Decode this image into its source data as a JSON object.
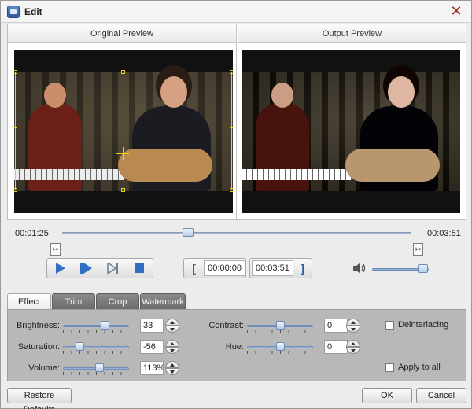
{
  "window": {
    "title": "Edit"
  },
  "preview": {
    "original_header": "Original Preview",
    "output_header": "Output Preview"
  },
  "timeline": {
    "current_time": "00:01:25",
    "total_time": "00:03:51",
    "position_fraction": 0.36
  },
  "playback": {
    "start_time": "00:00:00",
    "end_time": "00:03:51",
    "volume_fraction": 0.9
  },
  "tabs": [
    {
      "label": "Effect",
      "active": true
    },
    {
      "label": "Trim",
      "active": false
    },
    {
      "label": "Crop",
      "active": false
    },
    {
      "label": "Watermark",
      "active": false
    }
  ],
  "effect": {
    "brightness": {
      "label": "Brightness:",
      "value": "33",
      "level": 0.66
    },
    "saturation": {
      "label": "Saturation:",
      "value": "-56",
      "level": 0.22
    },
    "volume": {
      "label": "Volume:",
      "value": "113%",
      "level": 0.56
    },
    "contrast": {
      "label": "Contrast:",
      "value": "0",
      "level": 0.5
    },
    "hue": {
      "label": "Hue:",
      "value": "0",
      "level": 0.5
    },
    "deinterlacing_label": "Deinterlacing",
    "deinterlacing_checked": false,
    "apply_all_label": "Apply to all",
    "apply_all_checked": false
  },
  "footer": {
    "restore_label": "Restore Defaults",
    "ok_label": "OK",
    "cancel_label": "Cancel"
  },
  "colors": {
    "crop_frame": "#e8d315",
    "accent": "#2f5f9e",
    "close": "#a12a1e"
  }
}
